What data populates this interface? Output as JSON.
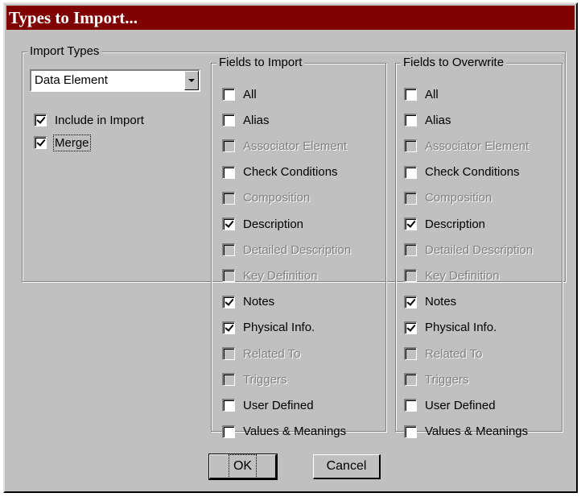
{
  "window": {
    "title": "Types to Import..."
  },
  "import_types": {
    "group_label": "Import Types",
    "group_label_mnemonic": "I",
    "type_select_value": "Data Element",
    "options": [
      {
        "label": "Include in Import",
        "checked": true
      },
      {
        "label": "Merge",
        "checked": true
      }
    ]
  },
  "fields_to_import": {
    "group_label": "Fields to Import",
    "items": [
      {
        "label": "All",
        "checked": false,
        "enabled": true
      },
      {
        "label": "Alias",
        "checked": false,
        "enabled": true
      },
      {
        "label": "Associator Element",
        "checked": false,
        "enabled": false
      },
      {
        "label": "Check Conditions",
        "checked": false,
        "enabled": true
      },
      {
        "label": "Composition",
        "checked": false,
        "enabled": false
      },
      {
        "label": "Description",
        "checked": true,
        "enabled": true
      },
      {
        "label": "Detailed Description",
        "checked": false,
        "enabled": false
      },
      {
        "label": "Key Definition",
        "checked": false,
        "enabled": false
      },
      {
        "label": "Notes",
        "checked": true,
        "enabled": true
      },
      {
        "label": "Physical Info.",
        "checked": true,
        "enabled": true
      },
      {
        "label": "Related To",
        "checked": false,
        "enabled": false
      },
      {
        "label": "Triggers",
        "checked": false,
        "enabled": false
      },
      {
        "label": "User Defined",
        "checked": false,
        "enabled": true
      },
      {
        "label": "Values & Meanings",
        "checked": false,
        "enabled": true
      }
    ]
  },
  "fields_to_overwrite": {
    "group_label": "Fields to Overwrite",
    "items": [
      {
        "label": "All",
        "checked": false,
        "enabled": true
      },
      {
        "label": "Alias",
        "checked": false,
        "enabled": true
      },
      {
        "label": "Associator Element",
        "checked": false,
        "enabled": false
      },
      {
        "label": "Check Conditions",
        "checked": false,
        "enabled": true
      },
      {
        "label": "Composition",
        "checked": false,
        "enabled": false
      },
      {
        "label": "Description",
        "checked": true,
        "enabled": true
      },
      {
        "label": "Detailed Description",
        "checked": false,
        "enabled": false
      },
      {
        "label": "Key Definition",
        "checked": false,
        "enabled": false
      },
      {
        "label": "Notes",
        "checked": true,
        "enabled": true
      },
      {
        "label": "Physical Info.",
        "checked": true,
        "enabled": true
      },
      {
        "label": "Related To",
        "checked": false,
        "enabled": false
      },
      {
        "label": "Triggers",
        "checked": false,
        "enabled": false
      },
      {
        "label": "User Defined",
        "checked": false,
        "enabled": true
      },
      {
        "label": "Values & Meanings",
        "checked": false,
        "enabled": true
      }
    ]
  },
  "buttons": {
    "ok": "OK",
    "cancel": "Cancel"
  },
  "colors": {
    "titlebar": "#7f0000",
    "face": "#c0c0c0",
    "disabled_text": "#808080"
  }
}
